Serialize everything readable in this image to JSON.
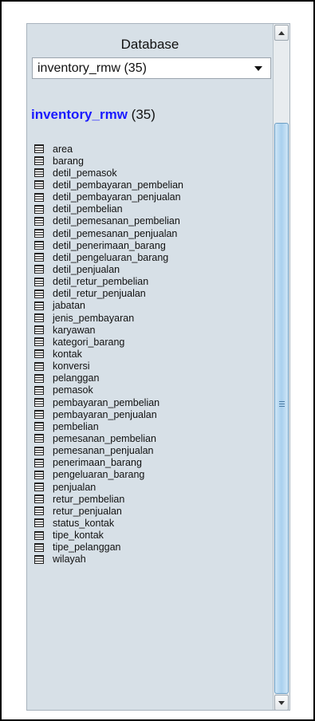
{
  "panel": {
    "label": "Database",
    "select_value": "inventory_rmw (35)",
    "heading_db": "inventory_rmw",
    "heading_count": " (35)"
  },
  "tables": [
    "area",
    "barang",
    "detil_pemasok",
    "detil_pembayaran_pembelian",
    "detil_pembayaran_penjualan",
    "detil_pembelian",
    "detil_pemesanan_pembelian",
    "detil_pemesanan_penjualan",
    "detil_penerimaan_barang",
    "detil_pengeluaran_barang",
    "detil_penjualan",
    "detil_retur_pembelian",
    "detil_retur_penjualan",
    "jabatan",
    "jenis_pembayaran",
    "karyawan",
    "kategori_barang",
    "kontak",
    "konversi",
    "pelanggan",
    "pemasok",
    "pembayaran_pembelian",
    "pembayaran_penjualan",
    "pembelian",
    "pemesanan_pembelian",
    "pemesanan_penjualan",
    "penerimaan_barang",
    "pengeluaran_barang",
    "penjualan",
    "retur_pembelian",
    "retur_penjualan",
    "status_kontak",
    "tipe_kontak",
    "tipe_pelanggan",
    "wilayah"
  ],
  "icons": {
    "table_icon": "table-icon",
    "scroll_up": "scroll-up-arrow-icon",
    "scroll_down": "scroll-down-arrow-icon",
    "dropdown": "chevron-down-icon"
  },
  "colors": {
    "panel_bg": "#d7e0e7",
    "link": "#1a1aff",
    "thumb": "#a9d0ee"
  }
}
